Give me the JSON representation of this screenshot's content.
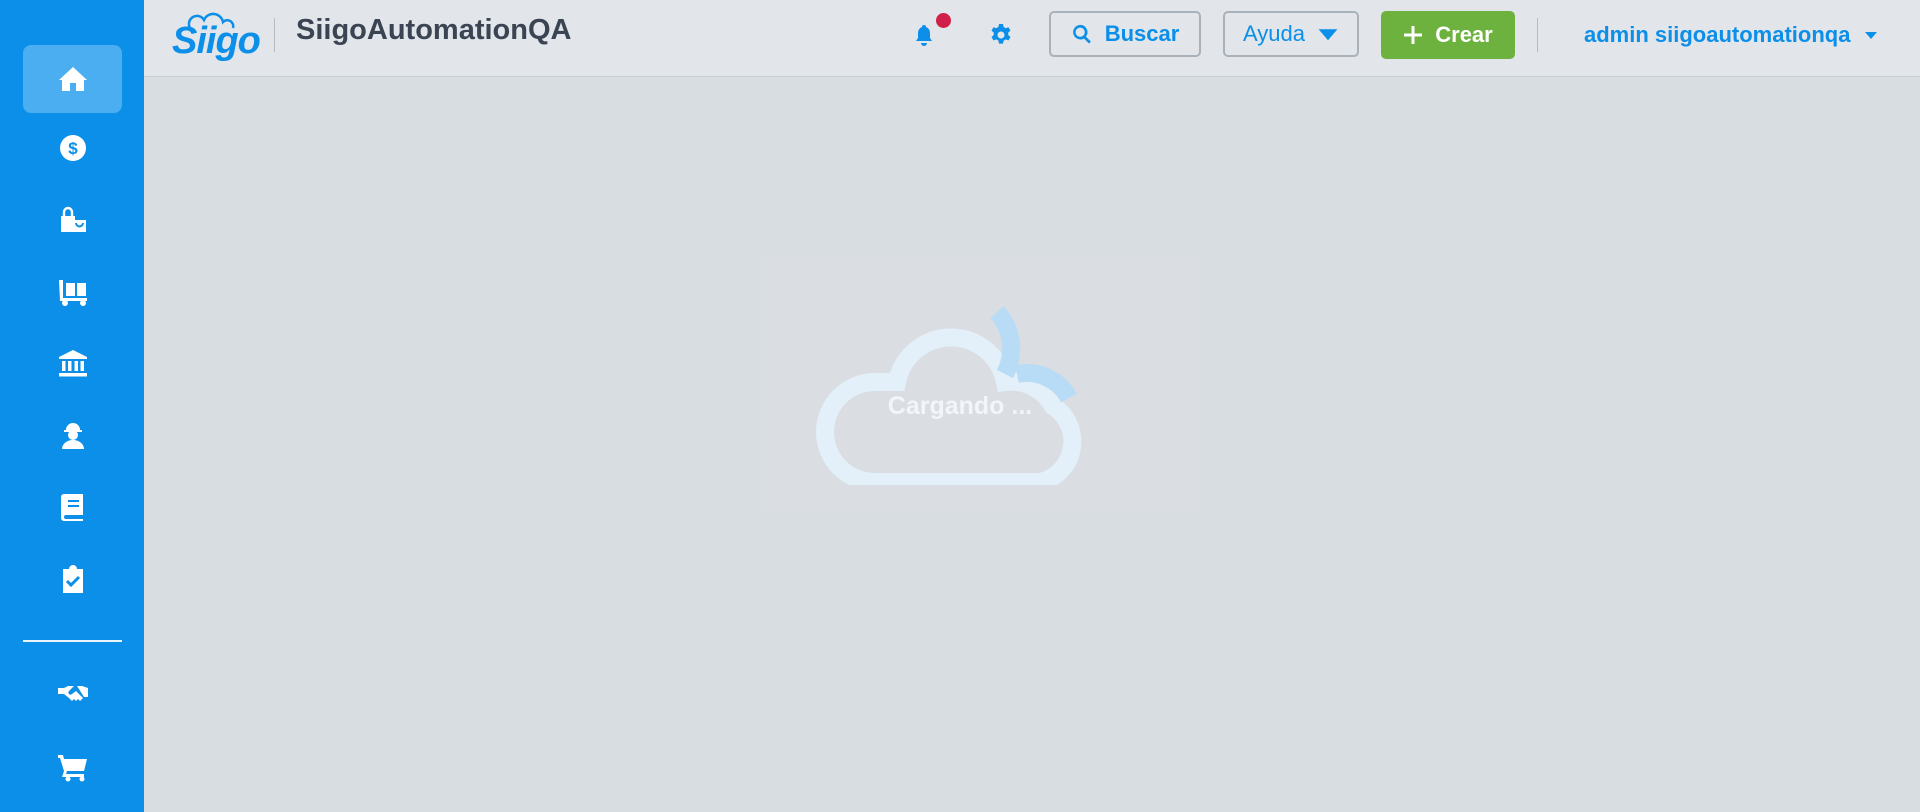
{
  "sidebar": {
    "items": [
      {
        "icon": "home-icon",
        "active": true
      },
      {
        "icon": "dollar-icon"
      },
      {
        "icon": "shopping-bag-icon"
      },
      {
        "icon": "dolly-icon"
      },
      {
        "icon": "bank-icon"
      },
      {
        "icon": "worker-icon"
      },
      {
        "icon": "book-icon"
      },
      {
        "icon": "clipboard-check-icon"
      },
      {
        "icon": "handshake-icon"
      },
      {
        "icon": "cart-icon"
      }
    ]
  },
  "header": {
    "logo_text": "Siigo",
    "company_name": "SiigoAutomationQA",
    "search_label": "Buscar",
    "help_label": "Ayuda",
    "create_label": "Crear",
    "user_label": "admin siigoautomationqa"
  },
  "loader": {
    "text": "Cargando ..."
  },
  "colors": {
    "brand": "#0b8fe8",
    "create": "#6db13e",
    "notification": "#d0204a"
  }
}
